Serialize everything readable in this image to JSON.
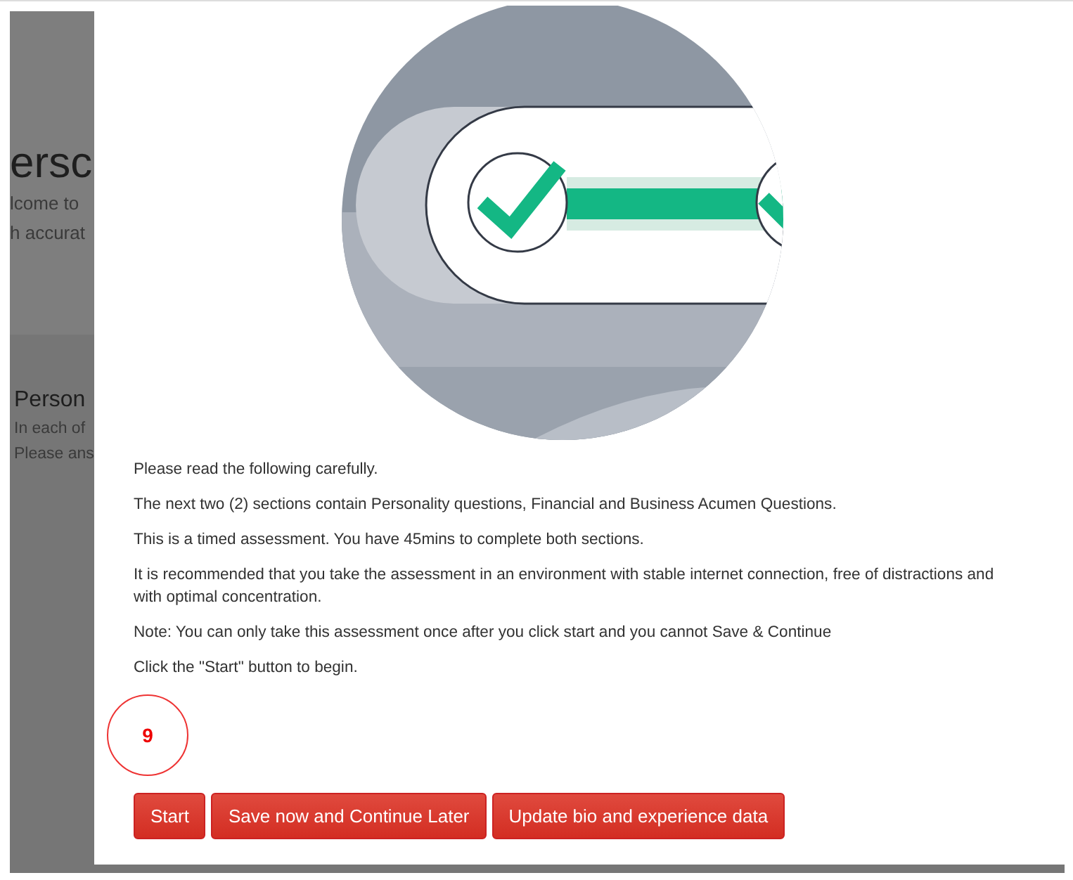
{
  "background_page": {
    "title": "ersc",
    "intro_lines": [
      "lcome to",
      "h accurat"
    ],
    "section": {
      "title": "Person",
      "lines": [
        "In each of",
        "Please ans"
      ]
    }
  },
  "modal": {
    "paragraphs": [
      "Please read the following carefully.",
      "The next two (2) sections contain Personality questions, Financial and Business Acumen Questions.",
      "This is a timed assessment. You have 45mins to complete both sections.",
      "It is recommended that you take the assessment in an environment with stable internet connection, free of distractions and with optimal concentration.",
      "Note: You can only take this assessment once after you click start and you cannot Save & Continue",
      "Click the \"Start\" button to begin."
    ],
    "annotation": {
      "label": "9"
    },
    "buttons": [
      "Start",
      "Save now and Continue Later",
      "Update bio and experience data"
    ]
  }
}
